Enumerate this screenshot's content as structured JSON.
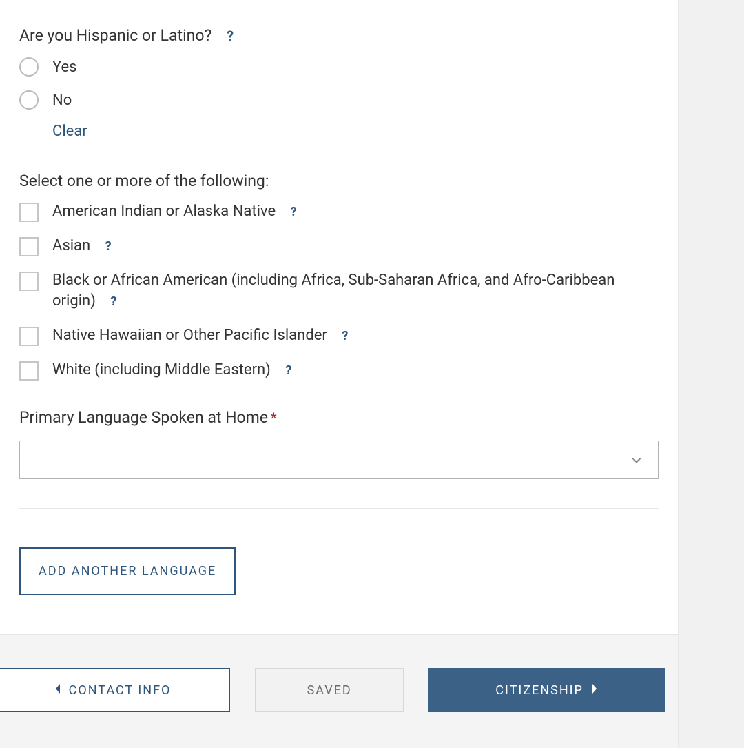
{
  "q_hispanic": "Are you Hispanic or Latino?",
  "opt_yes": "Yes",
  "opt_no": "No",
  "clear": "Clear",
  "q_select_race": "Select one or more of the following:",
  "race": {
    "american_indian": "American Indian or Alaska Native",
    "asian": "Asian",
    "black": "Black or African American (including Africa, Sub-Saharan Africa, and Afro-Caribbean origin)",
    "native_hawaiian": "Native Hawaiian or Other Pacific Islander",
    "white": "White (including Middle Eastern)"
  },
  "q_language": "Primary Language Spoken at Home",
  "language_value": "",
  "add_language": "ADD ANOTHER LANGUAGE",
  "footer": {
    "back": "CONTACT INFO",
    "saved": "SAVED",
    "next": "CITIZENSHIP"
  }
}
